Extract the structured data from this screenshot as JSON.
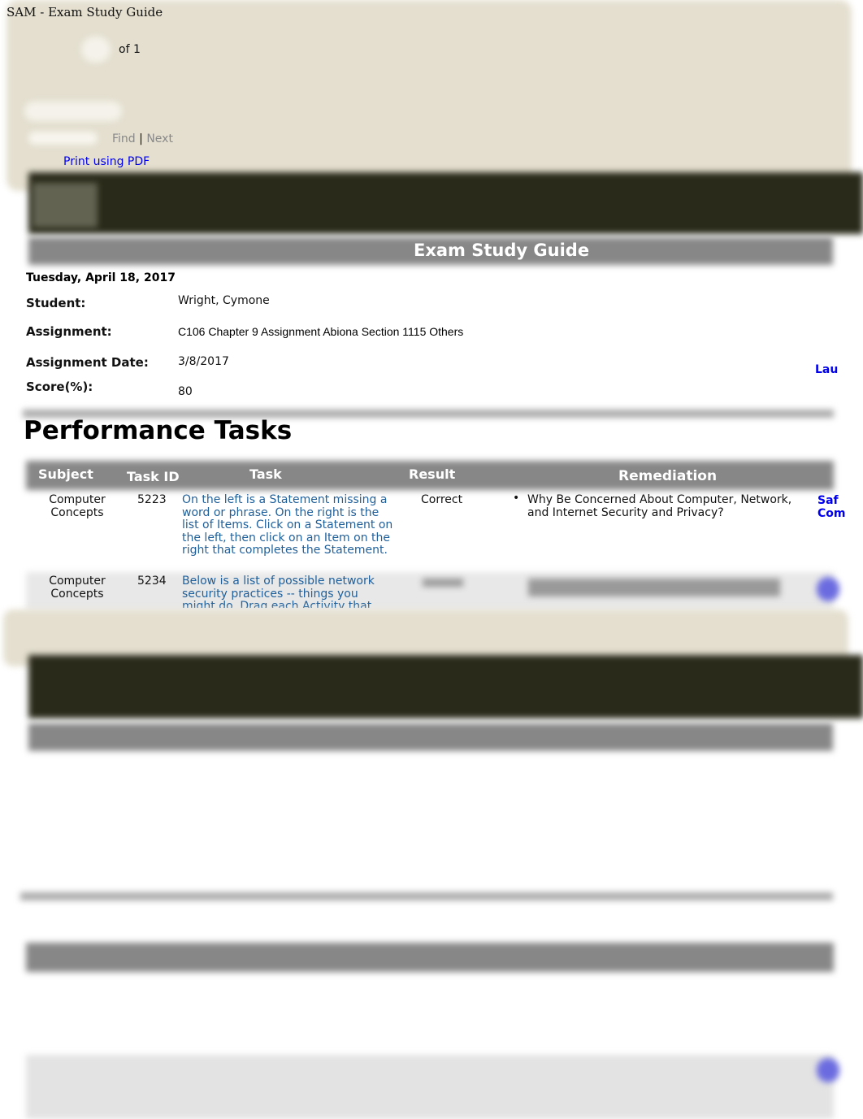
{
  "window_title": "SAM - Exam Study Guide",
  "toolbar": {
    "page_of": "of 1",
    "find": "Find",
    "separator": "|",
    "next": "Next",
    "print_pdf": "Print using PDF"
  },
  "report": {
    "title": "Exam Study Guide",
    "date": "Tuesday, April 18, 2017",
    "fields": [
      {
        "label": "Student:",
        "value": "Wright, Cymone"
      },
      {
        "label": "Assignment:",
        "value": "C106 Chapter 9 Assignment Abiona Section 1115 Others"
      },
      {
        "label": "Assignment Date:",
        "value": "3/8/2017"
      },
      {
        "label": "Score(%):",
        "value": "80"
      }
    ],
    "side_link": "Lau"
  },
  "performance": {
    "heading": "Performance Tasks",
    "columns": [
      "Subject",
      "Task ID",
      "Task",
      "Result",
      "Remediation"
    ],
    "rows": [
      {
        "subject": "Computer Concepts",
        "task_id": "5223",
        "task": "On the left is a Statement missing a word or phrase. On the right is the list of Items. Click on a Statement on the left, then click on an Item on the right that completes the Statement.",
        "result": "Correct",
        "remediation": "Why Be Concerned About Computer, Network, and Internet Security and Privacy?",
        "link": "Saf Com"
      },
      {
        "subject": "Computer Concepts",
        "task_id": "5234",
        "task": "Below is a list of possible network security practices -- things you might do. Drag each Activity that"
      }
    ]
  }
}
